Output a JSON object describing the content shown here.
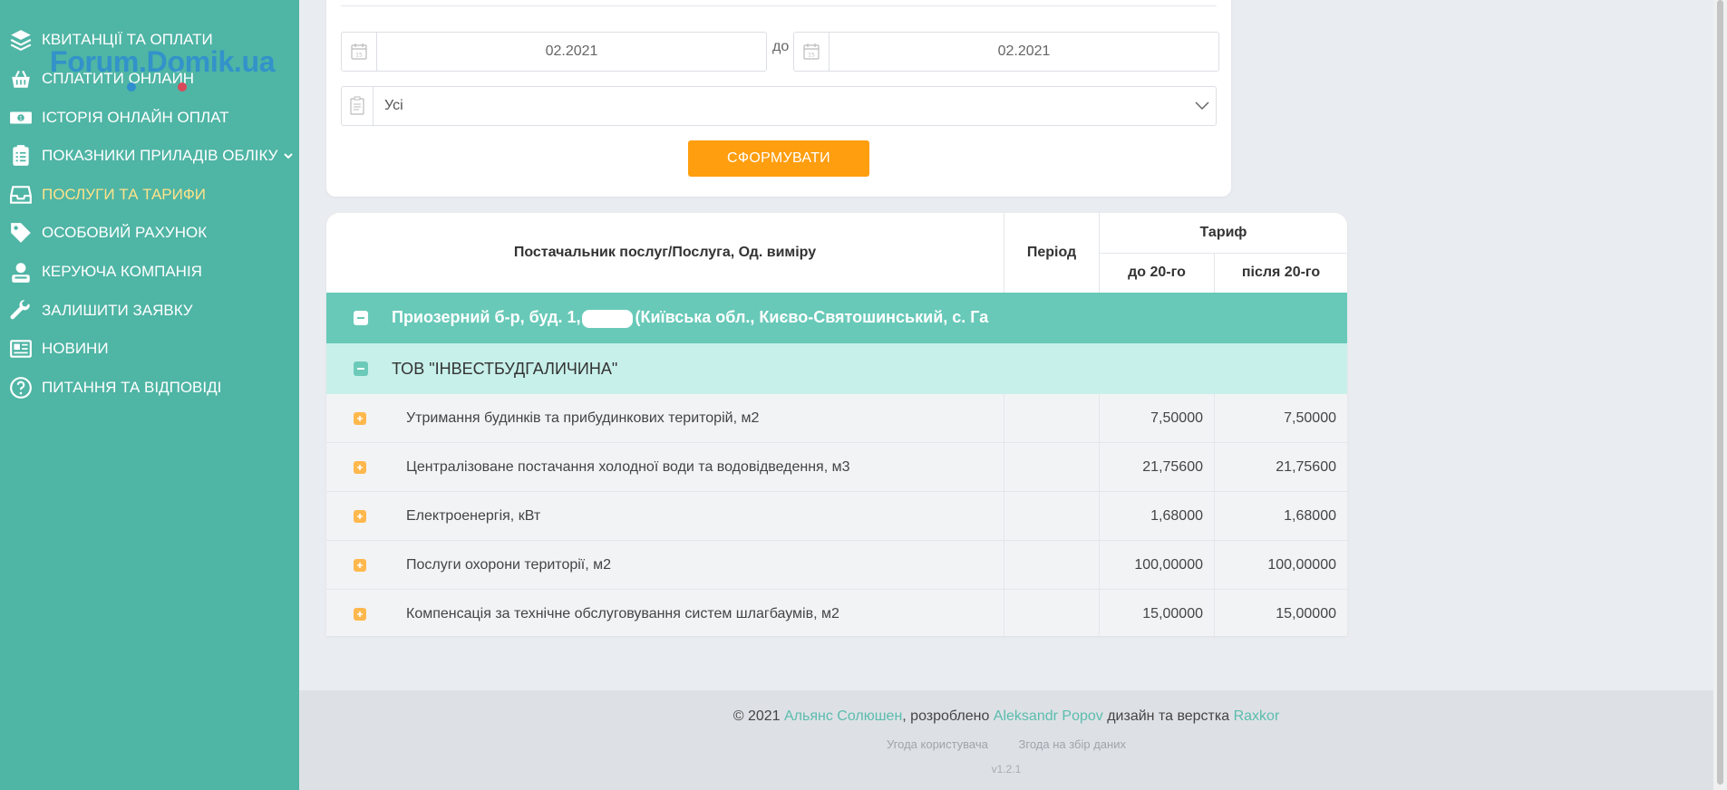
{
  "sidebar": {
    "watermark": "Forum.Domik.ua",
    "items": [
      {
        "label": "КВИТАНЦІЇ ТА ОПЛАТИ",
        "icon": "layers-icon",
        "active": false
      },
      {
        "label": "СПЛАТИТИ ОНЛАЙН",
        "icon": "basket-icon",
        "active": false
      },
      {
        "label": "ІСТОРІЯ ОНЛАЙН ОПЛАТ",
        "icon": "money-icon",
        "active": false
      },
      {
        "label": "ПОКАЗНИКИ ПРИЛАДІВ ОБЛІКУ",
        "icon": "clipboard-icon",
        "active": false,
        "has_submenu": true
      },
      {
        "label": "ПОСЛУГИ ТА ТАРИФИ",
        "icon": "inbox-icon",
        "active": true
      },
      {
        "label": "ОСОБОВИЙ РАХУНОК",
        "icon": "tag-icon",
        "active": false
      },
      {
        "label": "КЕРУЮЧА КОМПАНІЯ",
        "icon": "manager-icon",
        "active": false
      },
      {
        "label": "ЗАЛИШИТИ ЗАЯВКУ",
        "icon": "wrench-icon",
        "active": false
      },
      {
        "label": "НОВИНИ",
        "icon": "newspaper-icon",
        "active": false
      },
      {
        "label": "ПИТАННЯ ТА ВІДПОВІДІ",
        "icon": "question-icon",
        "active": false
      }
    ]
  },
  "filter": {
    "date_from": "02.2021",
    "date_separator": "до",
    "date_to": "02.2021",
    "calendar_day": "15",
    "service_select": "Усі",
    "submit_label": "СФОРМУВАТИ"
  },
  "table": {
    "headers": {
      "provider": "Постачальник послуг/Послуга, Од. виміру",
      "period": "Період",
      "tariff": "Тариф",
      "before_20": "до 20-го",
      "after_20": "після 20-го"
    },
    "address_prefix": "Приозерний б-р, буд. 1,",
    "address_suffix": "(Київська обл., Києво-Святошинський, с. Га",
    "provider_name": "ТОВ \"ІНВЕСТБУДГАЛИЧИНА\"",
    "rows": [
      {
        "service": "Утримання будинків та прибудинкових територій, м2",
        "period": "",
        "before_20": "7,50000",
        "after_20": "7,50000"
      },
      {
        "service": "Централізоване постачання холодної води та водовідведення, м3",
        "period": "",
        "before_20": "21,75600",
        "after_20": "21,75600"
      },
      {
        "service": "Електроенергія, кВт",
        "period": "",
        "before_20": "1,68000",
        "after_20": "1,68000"
      },
      {
        "service": "Послуги охорони території, м2",
        "period": "",
        "before_20": "100,00000",
        "after_20": "100,00000"
      },
      {
        "service": "Компенсація за технічне обслуговування систем шлагбаумів, м2",
        "period": "",
        "before_20": "15,00000",
        "after_20": "15,00000"
      }
    ]
  },
  "footer": {
    "copyright": "© 2021",
    "company": "Альянс Солюшен",
    "developed_by_text": ", розроблено",
    "developer": "Aleksandr Popov",
    "design_text": "дизайн та верстка",
    "designer": "Raxkor",
    "user_agreement": "Угода користувача",
    "data_consent": "Згода на збір даних",
    "version": "v1.2.1"
  },
  "colors": {
    "sidebar_bg": "#4fb5a5",
    "active_nav": "#ffe38a",
    "accent_orange": "#ff9e0f",
    "group_row": "#68c9b8",
    "sub_row": "#c8f0ea",
    "link": "#5bbcad"
  }
}
